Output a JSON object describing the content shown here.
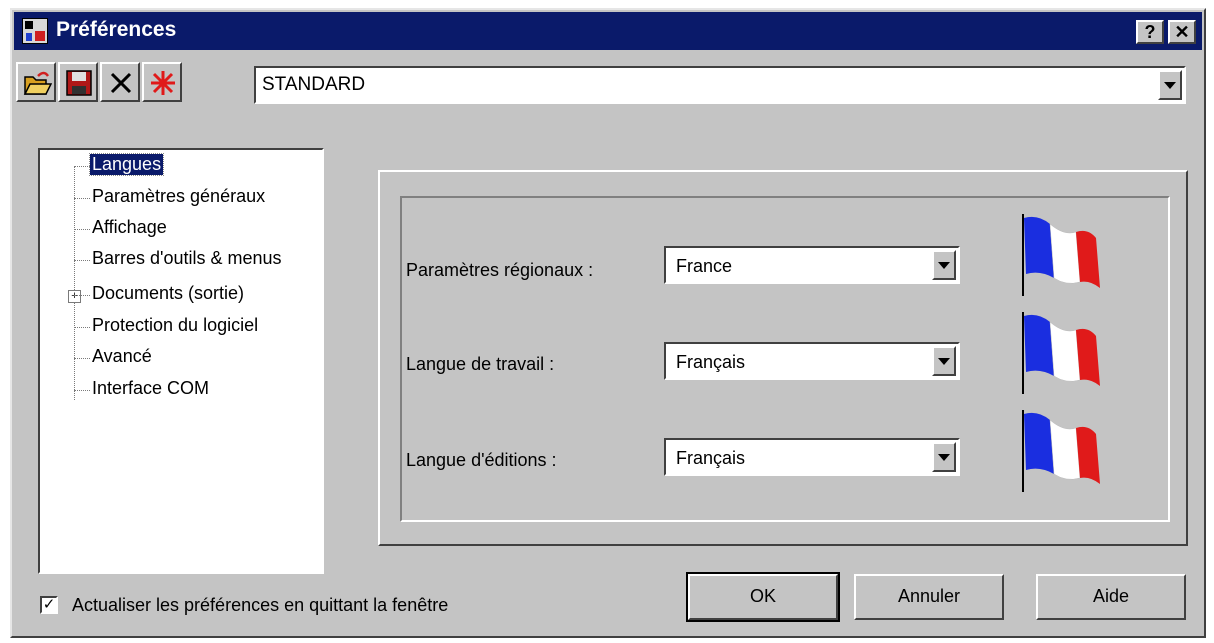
{
  "window": {
    "title": "Préférences",
    "help_button": "?",
    "close_button": "✕"
  },
  "toolbar": {
    "buttons": [
      "open-folder-icon",
      "save-floppy-icon",
      "delete-x-icon",
      "new-star-icon"
    ],
    "profile_value": "STANDARD"
  },
  "tree": {
    "items": [
      {
        "label": "Langues",
        "selected": true
      },
      {
        "label": "Paramètres généraux"
      },
      {
        "label": "Affichage"
      },
      {
        "label": "Barres d'outils & menus"
      },
      {
        "label": "Documents (sortie)",
        "expandable": true
      },
      {
        "label": "Protection du logiciel"
      },
      {
        "label": "Avancé"
      },
      {
        "label": "Interface COM"
      }
    ],
    "expander_symbol": "+"
  },
  "settings": [
    {
      "label": "Paramètres régionaux :",
      "value": "France",
      "flag": "french-flag-icon"
    },
    {
      "label": "Langue de travail :",
      "value": "Français",
      "flag": "french-flag-icon"
    },
    {
      "label": "Langue d'éditions :",
      "value": "Français",
      "flag": "french-flag-icon"
    }
  ],
  "options": {
    "update_on_close_label": "Actualiser les préférences en quittant la fenêtre",
    "update_on_close_checked": true,
    "check_mark": "✓"
  },
  "buttons": {
    "ok": "OK",
    "cancel": "Annuler",
    "help": "Aide"
  },
  "colors": {
    "titlebar": "#0a1a6a",
    "face": "#c4c4c4",
    "flag_blue": "#1a2ee0",
    "flag_red": "#e01a1a"
  }
}
